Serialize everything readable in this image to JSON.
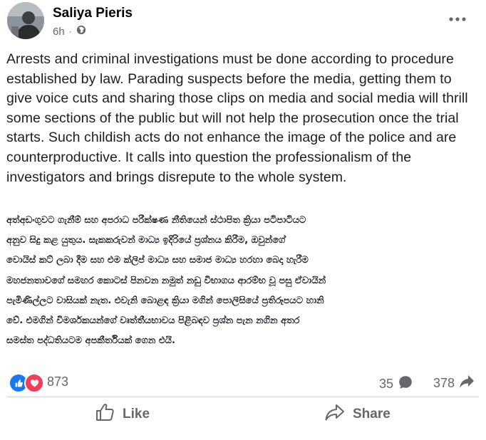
{
  "post": {
    "author": "Saliya Pieris",
    "time": "6h",
    "privacy_icon": "globe-icon",
    "body": "Arrests and criminal investigations must be done according to procedure established by law. Parading suspects before the media, getting them to give voice cuts and sharing those clips on media and social media will thrill some sections of the public but will not help the prosecution once the trial starts. Such childish acts do not enhance the image of the police and are counterproductive. It calls into question the professionalism of the investigators and brings disrepute to the whole system.",
    "sinhala_lines": [
      "අත්අඩංගුවට ගැනීම් සහ අපරාධ පරීක්ෂණ නීතියෙන් ස්ථාපිත ක්‍රියා පටිපාටියට",
      "අනුව සිදු කළ යුතුය. සැකකරුවන් මාධ්‍ය ඉදිරියේ ප්‍රශ්නය  කිරීම, ඔවුන්ගේ",
      "වොයිස් කට් ලබා දීම සහ එම ක්ලිප් මාධ්‍ය සහ සමාජ මාධ්‍ය හරහා බෙදා හැරීම",
      "මහජනතාවගේ සමහර කොටස් පිනවන නමුත් නඩු විභාගය ආරම්භ වූ පසු ඒවායින්",
      "පැමිණිල්ලට වාසියක් නැත. එවැනි බොළඳ ක්‍රියා මගින් පොලිසියේ ප්‍රතිරූපයට හානි",
      "වේ. එමගින් විමර්ශකයන්ගේ වෘත්තීයභාවය පිළිබඳව ප්‍රශ්න පැන නගින අතර",
      "සමස්ත පද්ධතියටම අපකීර්තියක් ගෙන එයි."
    ]
  },
  "stats": {
    "reactions_count": "873",
    "comments_count": "35",
    "shares_count": "378"
  },
  "actions": {
    "like_label": "Like",
    "share_label": "Share"
  },
  "colors": {
    "like_blue": "#1877f2",
    "love_red": "#f33e58",
    "secondary_text": "#65676b"
  }
}
